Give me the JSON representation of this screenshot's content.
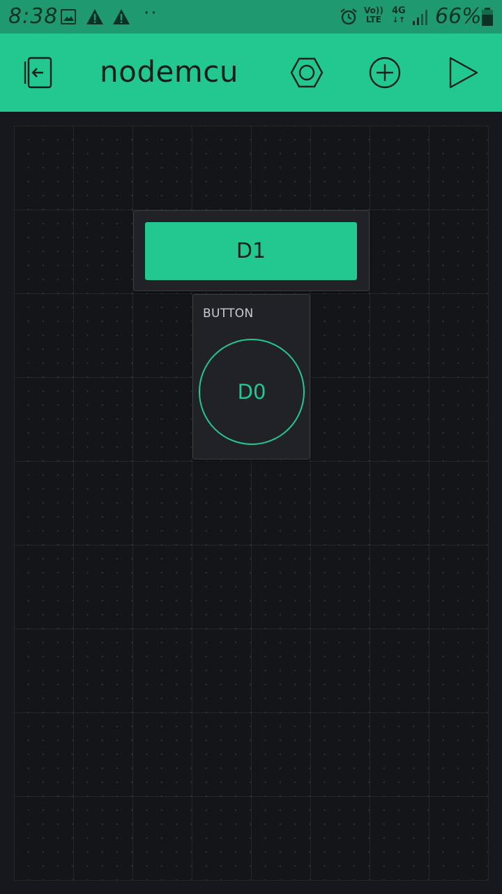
{
  "status_bar": {
    "time": "8:38",
    "dots": "··",
    "volte_top": "Vo))",
    "volte_bottom": "LTE",
    "network": "4G",
    "battery": "66%"
  },
  "header": {
    "title": "nodemcu",
    "icons": [
      "exit-icon",
      "settings-hexagon-icon",
      "add-icon",
      "play-icon"
    ]
  },
  "widgets": {
    "d1": {
      "label": "D1"
    },
    "d0": {
      "title": "BUTTON",
      "label": "D0"
    }
  },
  "colors": {
    "accent": "#23c890",
    "status_bar": "#1f9a70",
    "canvas": "#141519",
    "widget_bg": "#212227"
  }
}
